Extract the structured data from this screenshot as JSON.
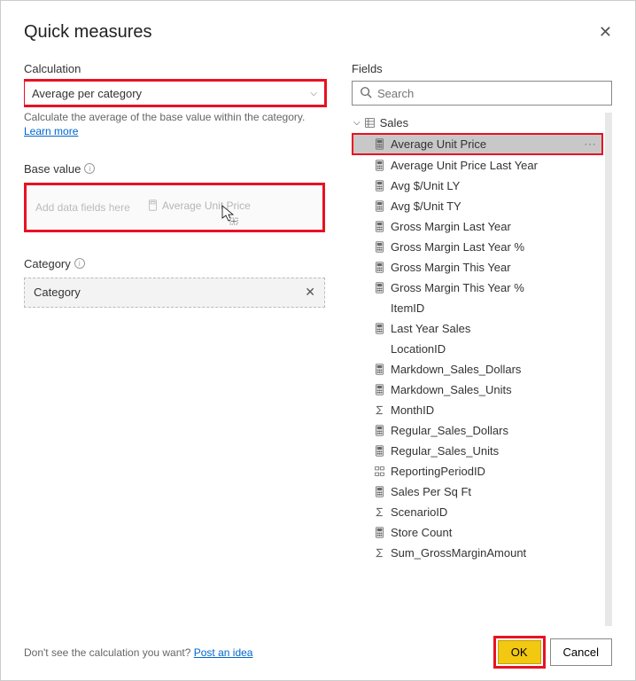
{
  "dialog": {
    "title": "Quick measures"
  },
  "calculation": {
    "label": "Calculation",
    "selected": "Average per category",
    "description": "Calculate the average of the base value within the category.",
    "learn_more": "Learn more"
  },
  "base_value": {
    "label": "Base value",
    "placeholder": "Add data fields here",
    "dragging": "Average Unit Price"
  },
  "category": {
    "label": "Category",
    "value": "Category"
  },
  "fields": {
    "label": "Fields",
    "search_placeholder": "Search",
    "table": "Sales",
    "items": [
      {
        "name": "Average Unit Price",
        "icon": "calc",
        "selected": true
      },
      {
        "name": "Average Unit Price Last Year",
        "icon": "calc"
      },
      {
        "name": "Avg $/Unit LY",
        "icon": "calc"
      },
      {
        "name": "Avg $/Unit TY",
        "icon": "calc"
      },
      {
        "name": "Gross Margin Last Year",
        "icon": "calc"
      },
      {
        "name": "Gross Margin Last Year %",
        "icon": "calc"
      },
      {
        "name": "Gross Margin This Year",
        "icon": "calc"
      },
      {
        "name": "Gross Margin This Year %",
        "icon": "calc"
      },
      {
        "name": "ItemID",
        "icon": "none"
      },
      {
        "name": "Last Year Sales",
        "icon": "calc"
      },
      {
        "name": "LocationID",
        "icon": "none"
      },
      {
        "name": "Markdown_Sales_Dollars",
        "icon": "calc"
      },
      {
        "name": "Markdown_Sales_Units",
        "icon": "calc"
      },
      {
        "name": "MonthID",
        "icon": "sigma"
      },
      {
        "name": "Regular_Sales_Dollars",
        "icon": "calc"
      },
      {
        "name": "Regular_Sales_Units",
        "icon": "calc"
      },
      {
        "name": "ReportingPeriodID",
        "icon": "hier"
      },
      {
        "name": "Sales Per Sq Ft",
        "icon": "calc"
      },
      {
        "name": "ScenarioID",
        "icon": "sigma"
      },
      {
        "name": "Store Count",
        "icon": "calc"
      },
      {
        "name": "Sum_GrossMarginAmount",
        "icon": "sigma"
      }
    ]
  },
  "footer": {
    "prompt": "Don't see the calculation you want? ",
    "post_idea": "Post an idea",
    "ok": "OK",
    "cancel": "Cancel"
  }
}
